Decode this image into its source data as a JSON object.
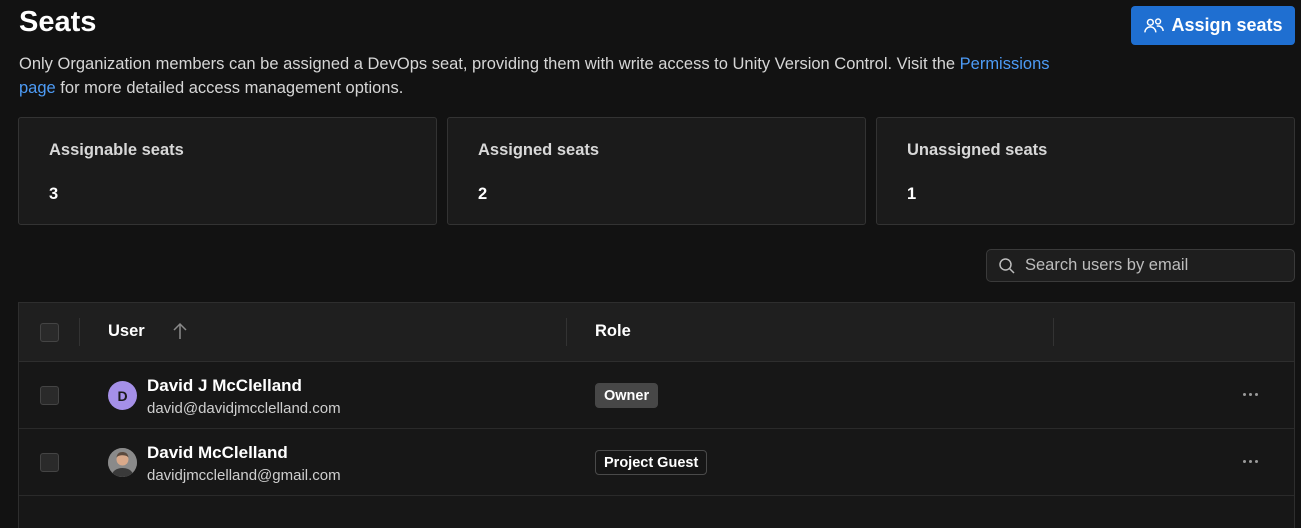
{
  "header": {
    "title": "Seats",
    "assign_label": "Assign seats",
    "description_before": "Only Organization members can be assigned a DevOps seat, providing them with write access to Unity Version Control. Visit the ",
    "description_link": "Permissions page",
    "description_after": " for more detailed access management options."
  },
  "stats": [
    {
      "label": "Assignable seats",
      "value": "3"
    },
    {
      "label": "Assigned seats",
      "value": "2"
    },
    {
      "label": "Unassigned seats",
      "value": "1"
    }
  ],
  "search": {
    "placeholder": "Search users by email",
    "value": ""
  },
  "table": {
    "columns": [
      "User",
      "Role"
    ],
    "sort": {
      "column": "User",
      "direction": "ascending"
    },
    "rows": [
      {
        "initial": "D",
        "name": "David J McClelland",
        "email": "david@davidjmcclelland.com",
        "role": "Owner"
      },
      {
        "initial": "",
        "name": "David McClelland",
        "email": "davidjmcclelland@gmail.com",
        "role": "Project Guest"
      }
    ]
  },
  "colors": {
    "accent": "#1f6fd1",
    "link": "#4d9bf5",
    "background": "#121212",
    "avatar_initial_bg": "#a590e8"
  },
  "icons": {
    "assign": "users-icon",
    "search": "search-icon",
    "sort": "arrow-up-icon",
    "row_menu": "more-horizontal-icon"
  }
}
